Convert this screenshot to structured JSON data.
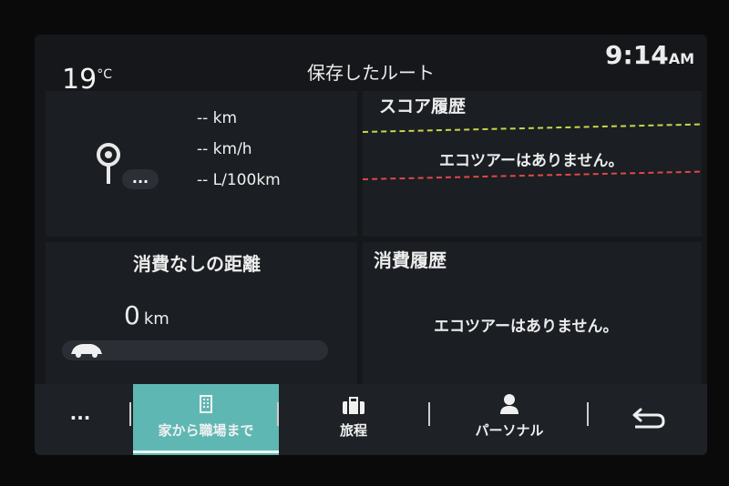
{
  "status": {
    "temperature": "19",
    "temp_unit": "°C",
    "title": "保存したルート",
    "time": "9:14",
    "ampm": "AM"
  },
  "top_left": {
    "distance": "-- km",
    "speed": "-- km/h",
    "consumption": "-- L/100km",
    "more_label": "..."
  },
  "score_history": {
    "title": "スコア履歴",
    "empty": "エコツアーはありません。"
  },
  "distance_no_fuel": {
    "title": "消費なしの距離",
    "value": "0",
    "unit": "km",
    "progress": 0
  },
  "consumption_history": {
    "title": "消費履歴",
    "empty": "エコツアーはありません。"
  },
  "nav": {
    "more": "...",
    "home_work": "家から職場まで",
    "trip": "旅程",
    "personal": "パーソナル"
  },
  "colors": {
    "accent": "#5fb7b3",
    "yellow_line": "#c8d64a",
    "red_line": "#e04848"
  }
}
